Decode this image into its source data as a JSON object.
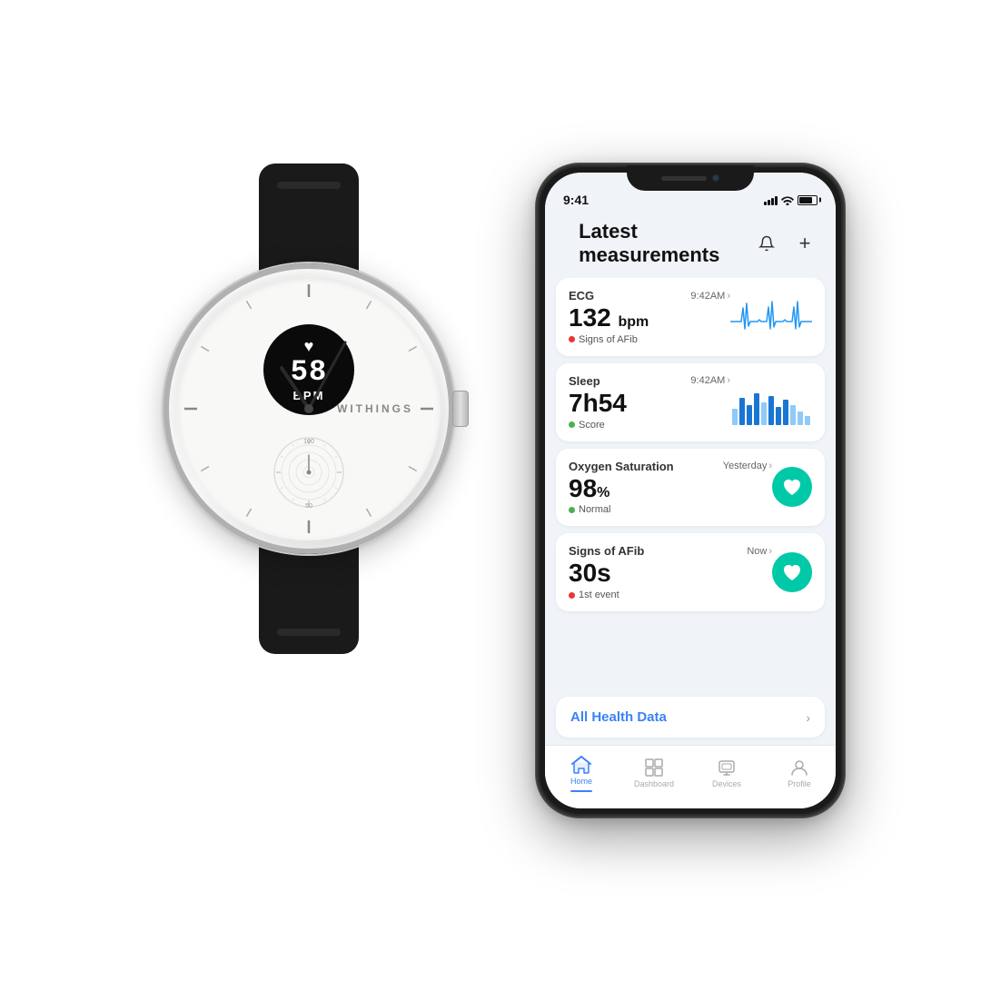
{
  "watch": {
    "brand": "WITHINGS",
    "bpm_value": "58",
    "bpm_unit": "BPM",
    "heart_icon": "♥"
  },
  "phone": {
    "status_bar": {
      "time": "9:41",
      "signal_label": "signal",
      "wifi_label": "wifi",
      "battery_label": "battery"
    },
    "header": {
      "title": "Latest measurements",
      "bell_icon": "🔔",
      "plus_icon": "+"
    },
    "cards": [
      {
        "label": "ECG",
        "time": "9:42AM",
        "value": "132",
        "unit": "bpm",
        "status_color": "#e53935",
        "status_text": "Signs of AFib",
        "has_ecg": true
      },
      {
        "label": "Sleep",
        "time": "9:42AM",
        "value": "7h",
        "value2": "54",
        "unit": "",
        "status_color": "#4caf50",
        "status_text": "Score",
        "has_sleep": true
      },
      {
        "label": "Oxygen Saturation",
        "time": "Yesterday",
        "value": "98",
        "unit": "%",
        "status_color": "#4caf50",
        "status_text": "Normal",
        "has_o2_icon": true
      },
      {
        "label": "Signs of AFib",
        "time": "Now",
        "value": "30s",
        "unit": "",
        "status_color": "#e53935",
        "status_text": "1st event",
        "has_afib_icon": true
      }
    ],
    "all_health": {
      "label": "All Health Data",
      "chevron": "›"
    },
    "nav": [
      {
        "icon": "⌂",
        "label": "Home",
        "active": true
      },
      {
        "icon": "▦",
        "label": "Dashboard",
        "active": false
      },
      {
        "icon": "⊞",
        "label": "Devices",
        "active": false
      },
      {
        "icon": "○",
        "label": "Profile",
        "active": false
      }
    ]
  }
}
